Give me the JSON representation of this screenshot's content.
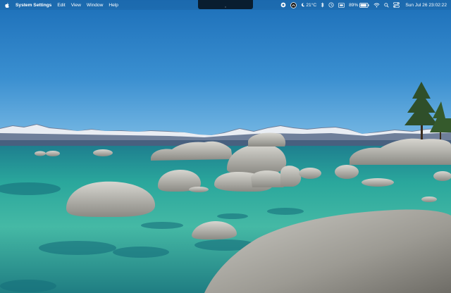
{
  "menubar": {
    "apple_icon": "apple-logo-icon",
    "app_name": "System Settings",
    "menus": [
      "Edit",
      "View",
      "Window",
      "Help"
    ],
    "status": {
      "weather_icon": "moon-icon",
      "weather_temp": "21°C",
      "battery_percent": "89%",
      "battery_level": 0.89,
      "datetime": "Sun Jul 26  23:02:22"
    },
    "status_icons": [
      "record-icon",
      "account-icon",
      "bluetooth-icon",
      "clock-icon",
      "screen-icon",
      "wifi-icon",
      "search-icon",
      "control-center-icon"
    ]
  },
  "desktop": {
    "wallpaper": "lake-with-boulders-and-mountains",
    "colors": {
      "sky_top": "#1f74bd",
      "sky_bottom": "#5aa7dc",
      "water": "#1f8f8c",
      "shallow_water": "#5fc9b1",
      "rock": "#b9b8b1"
    }
  }
}
